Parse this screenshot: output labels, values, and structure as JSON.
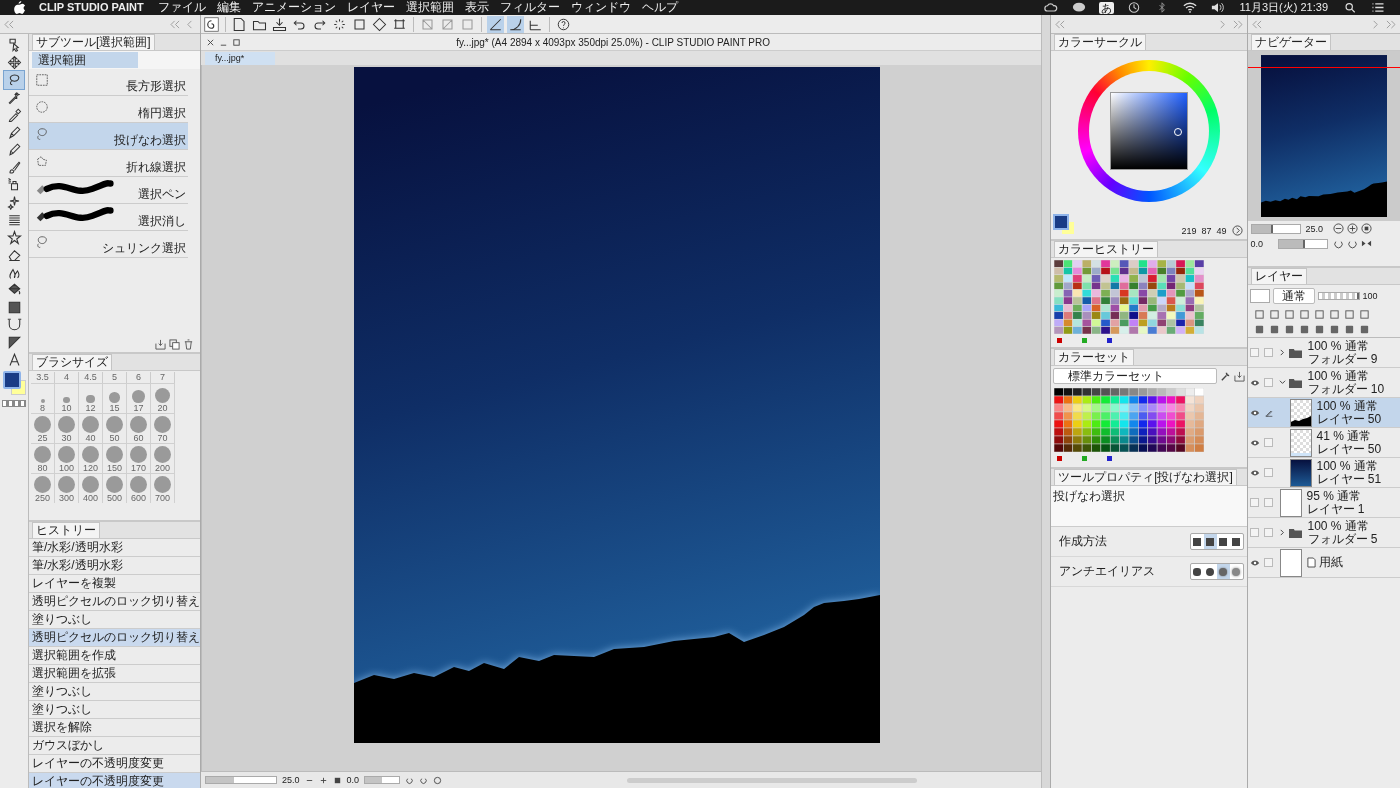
{
  "menubar": {
    "app_name": "CLIP STUDIO PAINT",
    "menus": [
      "ファイル",
      "編集",
      "アニメーション",
      "レイヤー",
      "選択範囲",
      "表示",
      "フィルター",
      "ウィンドウ",
      "ヘルプ"
    ],
    "ime": "あ",
    "datetime": "11月3日(火) 21:39"
  },
  "toolbar": {
    "snap_toggles": [
      {
        "selected": true
      },
      {
        "selected": true
      },
      {
        "selected": false
      }
    ]
  },
  "tools": [
    {
      "kind": "operation",
      "selected": false
    },
    {
      "kind": "move",
      "selected": false
    },
    {
      "kind": "lasso",
      "selected": true
    },
    {
      "kind": "wand",
      "selected": false
    },
    {
      "kind": "eyedropper",
      "selected": false
    },
    {
      "kind": "pen",
      "selected": false
    },
    {
      "kind": "pencil",
      "selected": false
    },
    {
      "kind": "brush",
      "selected": false
    },
    {
      "kind": "airbrush",
      "selected": false
    },
    {
      "kind": "decoration",
      "selected": false
    },
    {
      "kind": "lines",
      "selected": false
    },
    {
      "kind": "star",
      "selected": false
    },
    {
      "kind": "eraser",
      "selected": false
    },
    {
      "kind": "blend",
      "selected": false
    },
    {
      "kind": "fill",
      "selected": false
    },
    {
      "kind": "gradient",
      "selected": false
    },
    {
      "kind": "curve",
      "selected": false
    },
    {
      "kind": "ruler",
      "selected": false
    },
    {
      "kind": "text",
      "selected": false
    }
  ],
  "subtool": {
    "title": "サブツール[選択範囲]",
    "group": "選択範囲",
    "items": [
      {
        "kind": "rect",
        "label": "長方形選択",
        "selected": false
      },
      {
        "kind": "ellipse",
        "label": "楕円選択",
        "selected": false
      },
      {
        "kind": "lasso",
        "label": "投げなわ選択",
        "selected": true
      },
      {
        "kind": "polyline",
        "label": "折れ線選択",
        "selected": false
      },
      {
        "kind": "pen",
        "label": "選択ペン",
        "selected": false
      },
      {
        "kind": "eraser",
        "label": "選択消し",
        "selected": false
      },
      {
        "kind": "shrink",
        "label": "シュリンク選択",
        "selected": false
      }
    ]
  },
  "brush_size": {
    "title": "ブラシサイズ",
    "header": [
      "3.5",
      "4",
      "4.5",
      "5",
      "6",
      "7"
    ],
    "sizes": [
      "8",
      "10",
      "12",
      "15",
      "17",
      "20",
      "25",
      "30",
      "40",
      "50",
      "60",
      "70",
      "80",
      "100",
      "120",
      "150",
      "170",
      "200",
      "250",
      "300",
      "400",
      "500",
      "600",
      "700"
    ]
  },
  "history": {
    "title": "ヒストリー",
    "items": [
      {
        "label": "筆/水彩/透明水彩",
        "selected": false
      },
      {
        "label": "筆/水彩/透明水彩",
        "selected": false
      },
      {
        "label": "レイヤーを複製",
        "selected": false
      },
      {
        "label": "透明ピクセルのロック切り替え",
        "selected": false
      },
      {
        "label": "塗りつぶし",
        "selected": false
      },
      {
        "label": "透明ピクセルのロック切り替え",
        "selected": true
      },
      {
        "label": "選択範囲を作成",
        "selected": false
      },
      {
        "label": "選択範囲を拡張",
        "selected": false
      },
      {
        "label": "塗りつぶし",
        "selected": false
      },
      {
        "label": "塗りつぶし",
        "selected": false
      },
      {
        "label": "選択を解除",
        "selected": false
      },
      {
        "label": "ガウスぼかし",
        "selected": false
      },
      {
        "label": "レイヤーの不透明度変更",
        "selected": false
      },
      {
        "label": "レイヤーの不透明度変更",
        "selected": true
      }
    ]
  },
  "canvas": {
    "title": "fy...jpg* (A4 2894 x 4093px 350dpi 25.0%)  - CLIP STUDIO PAINT PRO",
    "tab": "fy...jpg*",
    "zoom": "25.0",
    "zoom_slider": {
      "level": 0.4
    },
    "angle": "0.0",
    "angle_slider": {
      "level": 0.5
    }
  },
  "color_circle": {
    "title": "カラーサークル",
    "h": "219",
    "s": "87",
    "v": "49"
  },
  "color_history": {
    "title": "カラーヒストリー"
  },
  "color_set": {
    "title": "カラーセット",
    "set_name": "標準カラーセット"
  },
  "tool_property": {
    "title": "ツールプロパティ[投げなわ選択]",
    "tool_name": "投げなわ選択",
    "rows": [
      {
        "label": "作成方法",
        "options": [
          {
            "selected": false
          },
          {
            "selected": true
          },
          {
            "selected": false
          },
          {
            "selected": false
          }
        ]
      },
      {
        "label": "アンチエイリアス",
        "options": [
          {
            "selected": false
          },
          {
            "selected": false
          },
          {
            "selected": true
          },
          {
            "selected": false
          }
        ]
      }
    ]
  },
  "navigator": {
    "title": "ナビゲーター",
    "zoom": "25.0",
    "zoom_slider": {
      "level": 0.4
    },
    "angle": "0.0",
    "angle_slider": {
      "level": 0.5
    }
  },
  "layers": {
    "title": "レイヤー",
    "blend_mode": "通常",
    "opacity": "100",
    "opacity_slider": {
      "level": 1
    },
    "items": [
      {
        "kind": "folder",
        "mode": "100 % 通常",
        "name": "フォルダー 9",
        "visible": false,
        "selected": false,
        "expanded": false
      },
      {
        "kind": "folder",
        "mode": "100 % 通常",
        "name": "フォルダー 10",
        "visible": true,
        "selected": false,
        "expanded": true,
        "children": [
          {
            "kind": "layer",
            "thumb": {
              "kind": "checker-dark"
            },
            "mode": "100 % 通常",
            "name": "レイヤー 50",
            "visible": true,
            "selected": true
          },
          {
            "kind": "layer",
            "thumb": {
              "kind": "checker-light"
            },
            "mode": "41 % 通常",
            "name": "レイヤー 50",
            "visible": true,
            "selected": false
          },
          {
            "kind": "layer",
            "thumb": {
              "kind": "navy"
            },
            "mode": "100 % 通常",
            "name": "レイヤー 51",
            "visible": true,
            "selected": false
          }
        ]
      },
      {
        "kind": "layer",
        "thumb": {
          "kind": "blank"
        },
        "mode": "95 % 通常",
        "name": "レイヤー 1",
        "visible": false,
        "selected": false
      },
      {
        "kind": "folder",
        "mode": "100 % 通常",
        "name": "フォルダー 5",
        "visible": false,
        "selected": false,
        "expanded": false
      },
      {
        "kind": "paper",
        "thumb": {
          "kind": "blank"
        },
        "name": "用紙",
        "visible": true,
        "selected": false
      }
    ]
  }
}
